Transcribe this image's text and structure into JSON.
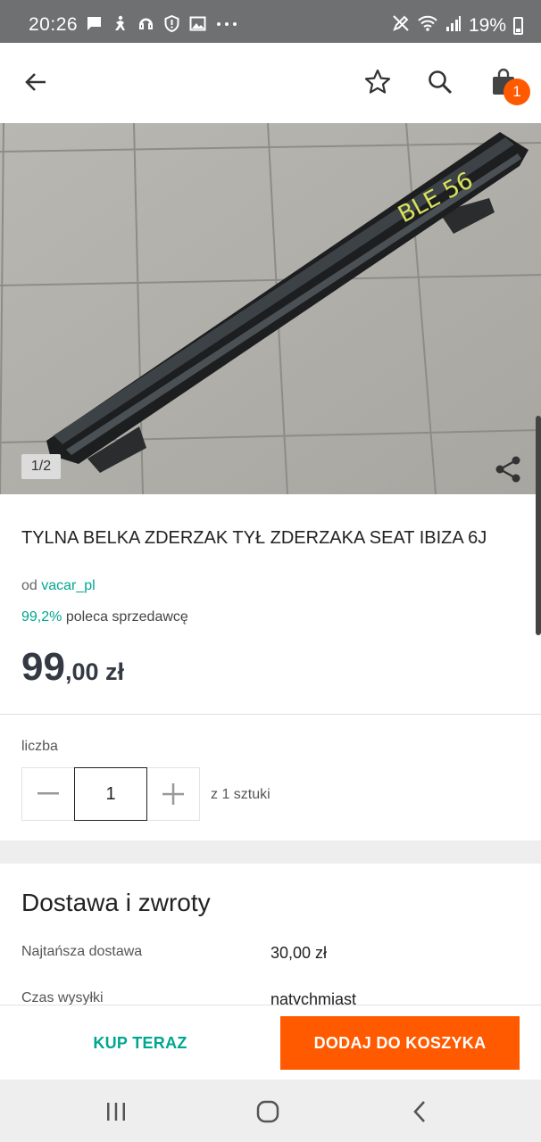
{
  "status_bar": {
    "time": "20:26",
    "battery": "19%",
    "left_icons": [
      "message-icon",
      "accessibility-icon",
      "headset-icon",
      "shield-icon",
      "image-icon",
      "more-dots-icon"
    ],
    "right_icons": [
      "pen-off-icon",
      "wifi-icon",
      "signal-icon",
      "battery-icon"
    ]
  },
  "app_bar": {
    "back_icon": "arrow-left-icon",
    "favorite_icon": "star-outline-icon",
    "search_icon": "search-icon",
    "cart_icon": "shopping-bag-icon",
    "cart_badge": "1"
  },
  "gallery": {
    "counter": "1/2",
    "share_icon": "share-icon"
  },
  "product": {
    "title": "TYLNA BELKA ZDERZAK TYŁ ZDERZAKA SEAT IBIZA 6J",
    "seller_prefix": "od",
    "seller_name": "vacar_pl",
    "recommend_pct": "99,2%",
    "recommend_text": "poleca sprzedawcę",
    "price_main": "99",
    "price_rest": ",00 zł"
  },
  "quantity": {
    "label": "liczba",
    "value": "1",
    "note": "z 1 sztuki"
  },
  "delivery": {
    "title": "Dostawa i zwroty",
    "rows": [
      {
        "label": "Najtańsza dostawa",
        "value": "30,00 zł"
      },
      {
        "label": "Czas wysyłki",
        "value": "natychmiast"
      }
    ]
  },
  "actions": {
    "buy_now": "KUP TERAZ",
    "add_to_cart": "DODAJ DO KOSZYKA"
  },
  "colors": {
    "accent_orange": "#ff5a00",
    "accent_teal": "#00a790",
    "price_color": "#343a44"
  }
}
